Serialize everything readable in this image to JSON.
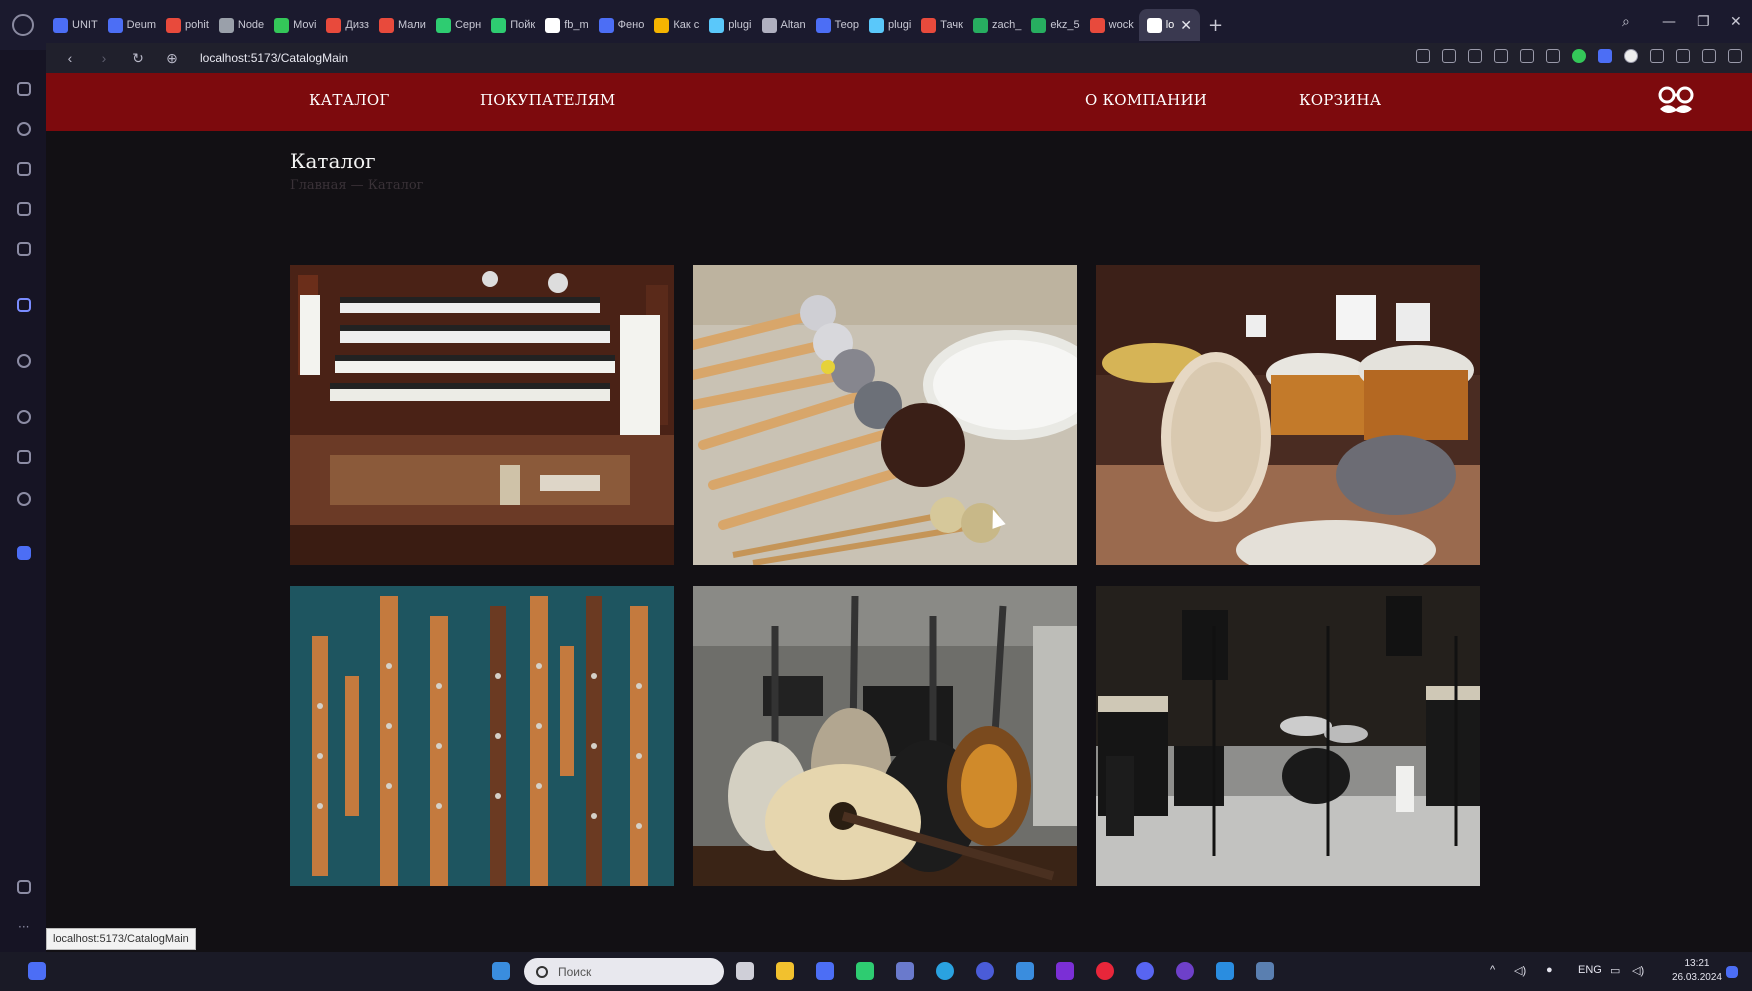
{
  "browser": {
    "tabs": [
      "UNIT",
      "Deum",
      "pohit",
      "Node",
      "Movi",
      "Дизз",
      "Мали",
      "Серн",
      "Пойк",
      "fb_m",
      "Фено",
      "Как с",
      "plugi",
      "Altan",
      "Теор",
      "plugi",
      "Тачк",
      "zach_",
      "ekz_5",
      "wock",
      "lo"
    ],
    "tab_colors": [
      "#4c6ef5",
      "#4c6ef5",
      "#e84a3c",
      "#9aa0aa",
      "#34c759",
      "#e84a3c",
      "#e84a3c",
      "#2ecc71",
      "#2ecc71",
      "#ffffff",
      "#4c6ef5",
      "#f5b400",
      "#5ac8fa",
      "#b0b0c0",
      "#4c6ef5",
      "#5ac8fa",
      "#e84a3c",
      "#27ae60",
      "#27ae60",
      "#e84a3c",
      "#ffffff"
    ],
    "url": "localhost:5173/CatalogMain",
    "status_url": "localhost:5173/CatalogMain"
  },
  "site": {
    "nav": {
      "catalog": "КАТАЛОГ",
      "buyers": "ПОКУПАТЕЛЯМ",
      "about": "О КОМПАНИИ",
      "cart": "КОРЗИНА"
    },
    "page_title": "Каталог",
    "breadcrumb": "Главная — Каталог",
    "colors": {
      "nav_bg": "#7d0a0d",
      "page_bg": "#121014",
      "text": "#f2f2f2"
    },
    "tiles": [
      {
        "name": "tile-organ",
        "subject": "organ keyboards"
      },
      {
        "name": "tile-mallets",
        "subject": "percussion mallets"
      },
      {
        "name": "tile-drums",
        "subject": "drum set and timpani"
      },
      {
        "name": "tile-clarinets",
        "subject": "wooden clarinets"
      },
      {
        "name": "tile-guitars",
        "subject": "acoustic and electric guitars"
      },
      {
        "name": "tile-studio",
        "subject": "rehearsal studio"
      }
    ]
  },
  "taskbar": {
    "search_placeholder": "Поиск",
    "language": "ENG",
    "time": "13:21",
    "date": "26.03.2024"
  }
}
